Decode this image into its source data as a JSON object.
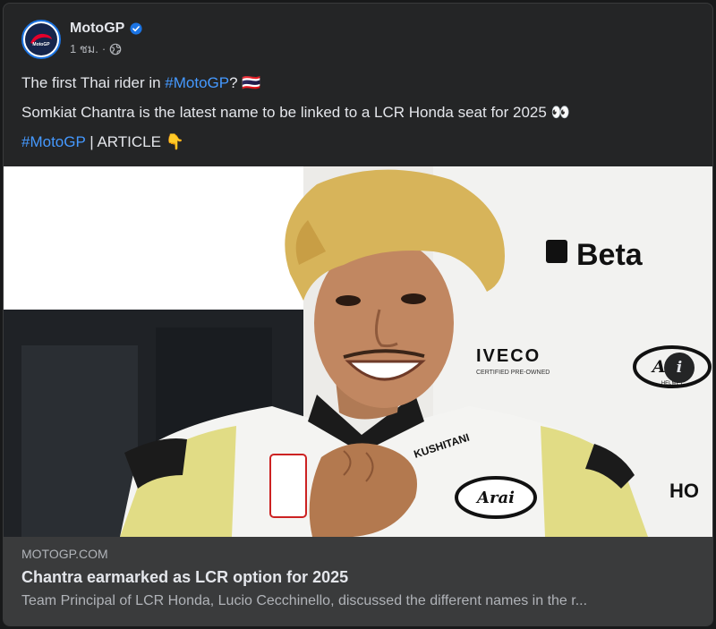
{
  "post": {
    "page_name": "MotoGP",
    "timestamp": "1 ชม.",
    "separator": "·",
    "avatar_text": "MotoGP",
    "line1": {
      "before": "The first Thai rider in ",
      "hashtag": "#MotoGP",
      "after": "? 🇹🇭"
    },
    "line2": "Somkiat Chantra is the latest name to be linked to a LCR Honda seat for 2025 👀",
    "line3": {
      "hashtag": "#MotoGP",
      "after": " | ARTICLE 👇"
    }
  },
  "photo": {
    "sponsors": [
      "Beta",
      "IVECO",
      "CERTIFIED PRE-OWNED",
      "Arai",
      "HELMET",
      "HO",
      "Arai",
      "KUSHITANI"
    ]
  },
  "info_button": "i",
  "link": {
    "domain": "MOTOGP.COM",
    "title": "Chantra earmarked as LCR option for 2025",
    "description": "Team Principal of LCR Honda, Lucio Cecchinello, discussed the different names in the r..."
  },
  "colors": {
    "background": "#242526",
    "hashtag": "#4599ff",
    "verified": "#1b74e4",
    "link_preview_bg": "#3a3b3c"
  }
}
